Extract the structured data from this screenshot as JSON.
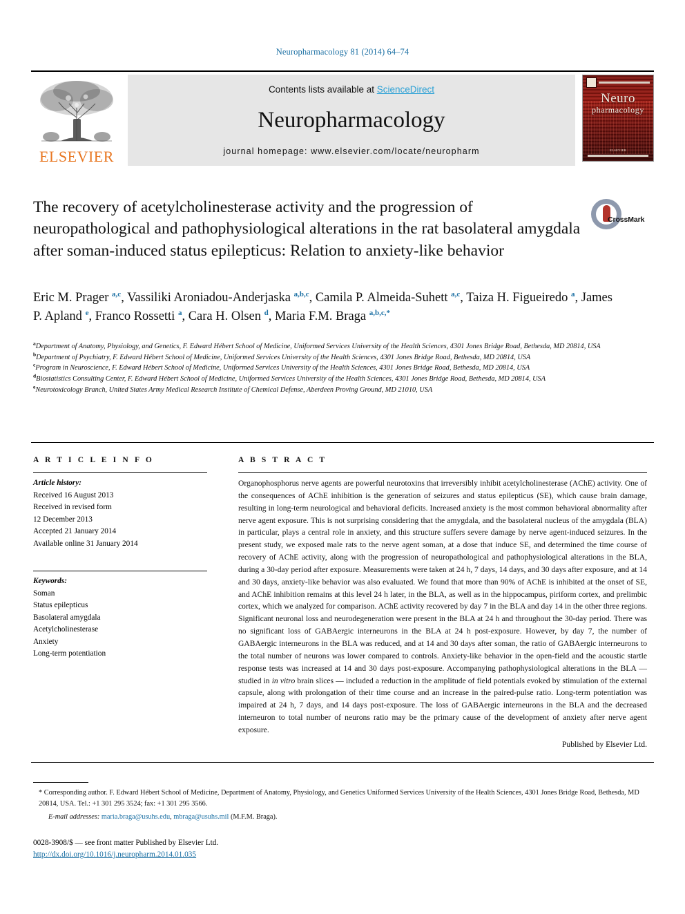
{
  "running_head": "Neuropharmacology 81 (2014) 64–74",
  "masthead": {
    "contents_prefix": "Contents lists available at ",
    "sciencedirect": "ScienceDirect",
    "journal_name": "Neuropharmacology",
    "homepage": "journal homepage: www.elsevier.com/locate/neuropharm",
    "publisher_wordmark": "ELSEVIER",
    "cover": {
      "title_line1": "Neuro",
      "title_line2": "pharmacology",
      "foot": "ELSEVIER"
    },
    "colors": {
      "elsevier_orange": "#E87722",
      "sciencedirect_blue": "#2aa0d5",
      "banner_gray": "#e6e6e6",
      "cover_red": "#7d1410"
    }
  },
  "crossmark": {
    "label": "CrossMark"
  },
  "title": "The recovery of acetylcholinesterase activity and the progression of neuropathological and pathophysiological alterations in the rat basolateral amygdala after soman-induced status epilepticus: Relation to anxiety-like behavior",
  "authors_html": "Eric M. Prager <sup>a,c</sup>, Vassiliki Aroniadou-Anderjaska <sup>a,b,c</sup>, Camila P. Almeida-Suhett <sup>a,c</sup>, Taiza H. Figueiredo <sup>a</sup>, James P. Apland <sup>e</sup>, Franco Rossetti <sup>a</sup>, Cara H. Olsen <sup>d</sup>, Maria F.M. Braga <sup>a,b,c,</sup><sup>*</sup>",
  "affiliations": [
    {
      "marker": "a",
      "text": "Department of Anatomy, Physiology, and Genetics, F. Edward Hébert School of Medicine, Uniformed Services University of the Health Sciences, 4301 Jones Bridge Road, Bethesda, MD 20814, USA"
    },
    {
      "marker": "b",
      "text": "Department of Psychiatry, F. Edward Hébert School of Medicine, Uniformed Services University of the Health Sciences, 4301 Jones Bridge Road, Bethesda, MD 20814, USA"
    },
    {
      "marker": "c",
      "text": "Program in Neuroscience, F. Edward Hébert School of Medicine, Uniformed Services University of the Health Sciences, 4301 Jones Bridge Road, Bethesda, MD 20814, USA"
    },
    {
      "marker": "d",
      "text": "Biostatistics Consulting Center, F. Edward Hébert School of Medicine, Uniformed Services University of the Health Sciences, 4301 Jones Bridge Road, Bethesda, MD 20814, USA"
    },
    {
      "marker": "e",
      "text": "Neurotoxicology Branch, United States Army Medical Research Institute of Chemical Defense, Aberdeen Proving Ground, MD 21010, USA"
    }
  ],
  "article_info": {
    "heading": "A R T I C L E  I N F O",
    "history_label": "Article history:",
    "history": [
      "Received 16 August 2013",
      "Received in revised form",
      "12 December 2013",
      "Accepted 21 January 2014",
      "Available online 31 January 2014"
    ],
    "keywords_label": "Keywords:",
    "keywords": [
      "Soman",
      "Status epilepticus",
      "Basolateral amygdala",
      "Acetylcholinesterase",
      "Anxiety",
      "Long-term potentiation"
    ]
  },
  "abstract": {
    "heading": "A B S T R A C T",
    "body_html": "Organophosphorus nerve agents are powerful neurotoxins that irreversibly inhibit acetylcholinesterase (AChE) activity. One of the consequences of AChE inhibition is the generation of seizures and status epilepticus (SE), which cause brain damage, resulting in long-term neurological and behavioral deficits. Increased anxiety is the most common behavioral abnormality after nerve agent exposure. This is not surprising considering that the amygdala, and the basolateral nucleus of the amygdala (BLA) in particular, plays a central role in anxiety, and this structure suffers severe damage by nerve agent-induced seizures. In the present study, we exposed male rats to the nerve agent soman, at a dose that induce SE, and determined the time course of recovery of AChE activity, along with the progression of neuropathological and pathophysiological alterations in the BLA, during a 30-day period after exposure. Measurements were taken at 24 h, 7 days, 14 days, and 30 days after exposure, and at 14 and 30 days, anxiety-like behavior was also evaluated. We found that more than 90% of AChE is inhibited at the onset of SE, and AChE inhibition remains at this level 24 h later, in the BLA, as well as in the hippocampus, piriform cortex, and prelimbic cortex, which we analyzed for comparison. AChE activity recovered by day 7 in the BLA and day 14 in the other three regions. Significant neuronal loss and neurodegeneration were present in the BLA at 24 h and throughout the 30-day period. There was no significant loss of GABAergic interneurons in the BLA at 24 h post-exposure. However, by day 7, the number of GABAergic interneurons in the BLA was reduced, and at 14 and 30 days after soman, the ratio of GABAergic interneurons to the total number of neurons was lower compared to controls. Anxiety-like behavior in the open-field and the acoustic startle response tests was increased at 14 and 30 days post-exposure. Accompanying pathophysiological alterations in the BLA — studied in <i>in vitro</i> brain slices — included a reduction in the amplitude of field potentials evoked by stimulation of the external capsule, along with prolongation of their time course and an increase in the paired-pulse ratio. Long-term potentiation was impaired at 24 h, 7 days, and 14 days post-exposure. The loss of GABAergic interneurons in the BLA and the decreased interneuron to total number of neurons ratio may be the primary cause of the development of anxiety after nerve agent exposure.",
    "closing": "Published by Elsevier Ltd."
  },
  "footnote": {
    "corresponding_html": "* Corresponding author. F. Edward Hébert School of Medicine, Department of Anatomy, Physiology, and Genetics Uniformed Services University of the Health Sciences, 4301 Jones Bridge Road, Bethesda, MD 20814, USA. Tel.: +1 301 295 3524; fax: +1 301 295 3566.",
    "email_label": "E-mail addresses:",
    "email1": "maria.braga@usuhs.edu",
    "email2": "mbraga@usuhs.mil",
    "email_suffix": "(M.F.M. Braga)."
  },
  "imprint": {
    "issn_line": "0028-3908/$ — see front matter Published by Elsevier Ltd.",
    "doi": "http://dx.doi.org/10.1016/j.neuropharm.2014.01.035"
  }
}
